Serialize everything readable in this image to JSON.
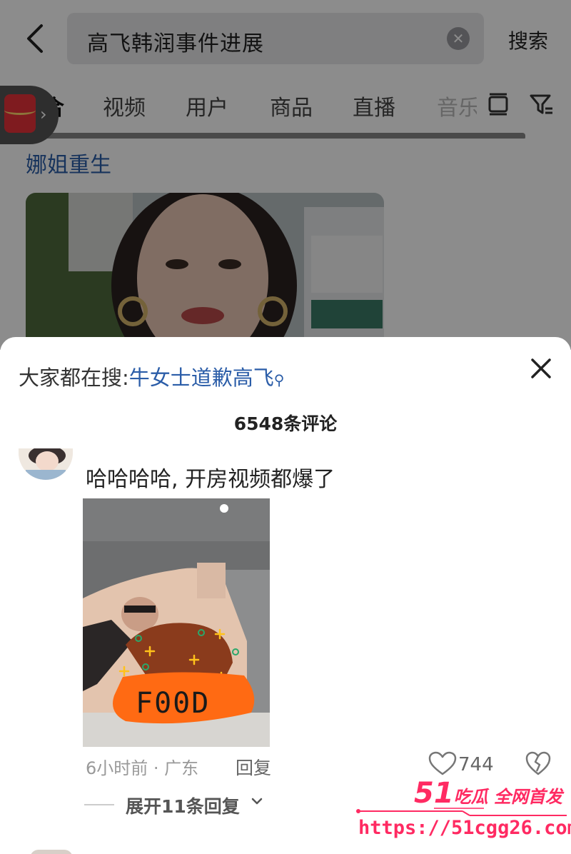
{
  "search": {
    "query": "高飞韩润事件进展",
    "submit_label": "搜索"
  },
  "tabs": [
    {
      "label": "综合",
      "active": true
    },
    {
      "label": "视频",
      "active": false
    },
    {
      "label": "用户",
      "active": false
    },
    {
      "label": "商品",
      "active": false
    },
    {
      "label": "直播",
      "active": false
    },
    {
      "label": "音乐",
      "active": false
    }
  ],
  "result": {
    "snippet_tail": "娜姐重生"
  },
  "sheet": {
    "trending_prefix": "大家都在搜:",
    "trending_topic": "牛女士道歉高飞",
    "comment_count_label": "6548条评论"
  },
  "comment": {
    "text": "哈哈哈哈, 开房视频都爆了",
    "sticker_text": "F00D",
    "time": "6小时前",
    "location": "广东",
    "reply_label": "回复",
    "likes": "744",
    "expand_label": "展开11条回复"
  },
  "watermark": {
    "brand_num": "51",
    "brand_text": "吃瓜 全网首发",
    "url": "https://51cgg26.com"
  },
  "colors": {
    "link_blue": "#2b5da8",
    "watermark_pink": "#ff2a62",
    "dim_overlay": "rgba(0,0,0,0.45)"
  }
}
